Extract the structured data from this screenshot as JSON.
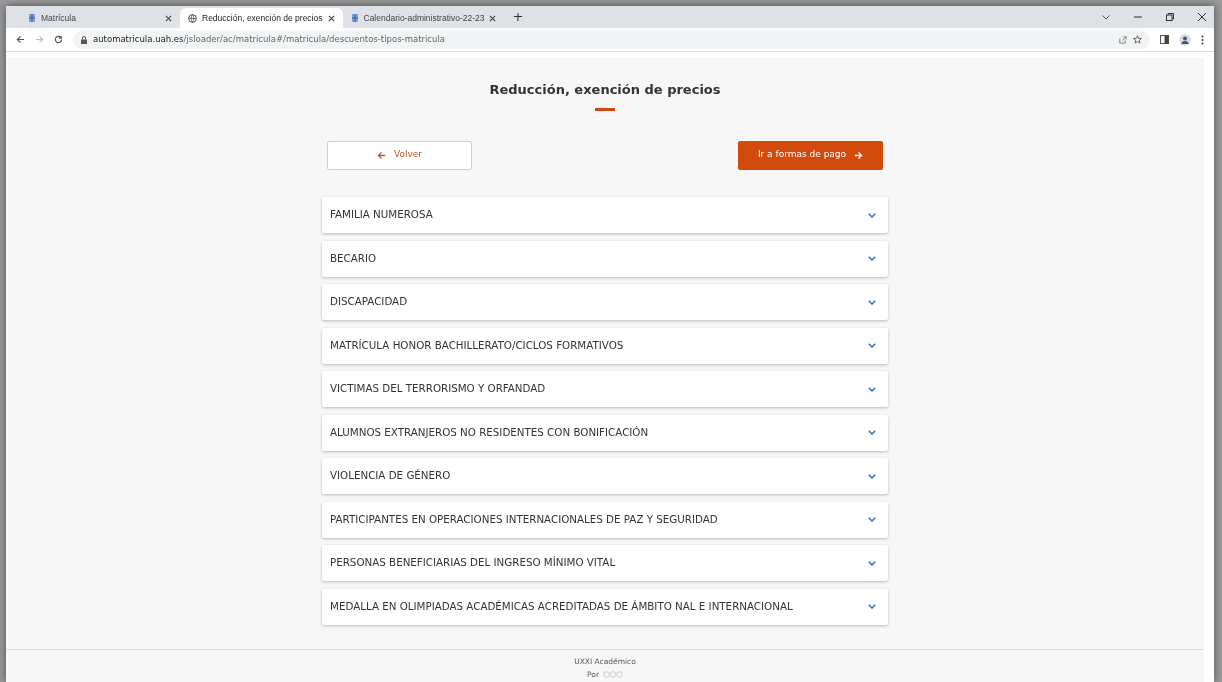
{
  "browser": {
    "tabs": [
      {
        "title": "Matrícula",
        "selected": false
      },
      {
        "title": "Reducción, exención de precios",
        "selected": true
      },
      {
        "title": "Calendario-administrativo-22-23",
        "selected": false
      }
    ],
    "new_tab": "+",
    "url_host": "automatricula.uah.es",
    "url_path": "/jsloader/ac/matricula#/matricula/descuentos-tipos-matricula"
  },
  "page": {
    "title": "Reducción, exención de precios",
    "back_button": "Volver",
    "next_button": "Ir a formas de pago",
    "sections": [
      {
        "label": "FAMILIA NUMEROSA",
        "expanded": false
      },
      {
        "label": "BECARIO",
        "expanded": false
      },
      {
        "label": "DISCAPACIDAD",
        "expanded": false
      },
      {
        "label": "MATRÍCULA HONOR BACHILLERATO/CICLOS FORMATIVOS",
        "expanded": false
      },
      {
        "label": "VICTIMAS DEL TERRORISMO Y ORFANDAD",
        "expanded": false
      },
      {
        "label": "ALUMNOS EXTRANJEROS NO RESIDENTES CON BONIFICACIÓN",
        "expanded": false
      },
      {
        "label": "VIOLENCIA DE GÉNERO",
        "expanded": false
      },
      {
        "label": "PARTICIPANTES EN OPERACIONES INTERNACIONALES DE PAZ Y SEGURIDAD",
        "expanded": false
      },
      {
        "label": "PERSONAS BENEFICIARIAS DEL INGRESO MÍNIMO VITAL",
        "expanded": false
      },
      {
        "label": "MEDALLA EN OLIMPIADAS ACADÉMICAS ACREDITADAS DE ÁMBITO NAL E INTERNACIONAL",
        "expanded": false
      }
    ]
  },
  "footer": {
    "product": "UXXI Académico",
    "by": "Por"
  }
}
